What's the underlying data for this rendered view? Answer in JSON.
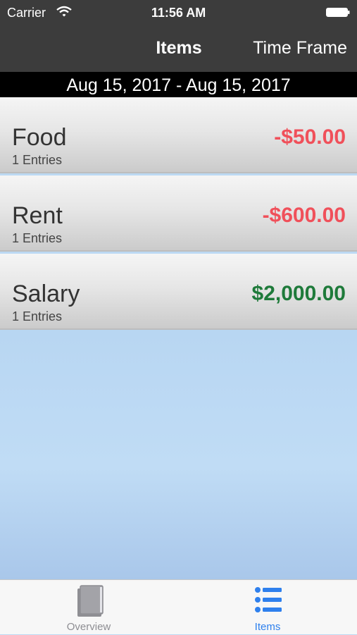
{
  "status_bar": {
    "carrier": "Carrier",
    "time": "11:56 AM"
  },
  "nav": {
    "title": "Items",
    "right_button": "Time Frame"
  },
  "date_range": "Aug 15, 2017 - Aug 15, 2017",
  "items": [
    {
      "name": "Food",
      "entries": "1 Entries",
      "amount": "-$50.00",
      "color": "#f0505a"
    },
    {
      "name": "Rent",
      "entries": "1 Entries",
      "amount": "-$600.00",
      "color": "#f0505a"
    },
    {
      "name": "Salary",
      "entries": "1 Entries",
      "amount": "$2,000.00",
      "color": "#1e7a3a"
    }
  ],
  "tabs": [
    {
      "label": "Overview",
      "icon": "book-icon",
      "color": "#8e8e93"
    },
    {
      "label": "Items",
      "icon": "list-icon",
      "color": "#2f80ed"
    }
  ]
}
